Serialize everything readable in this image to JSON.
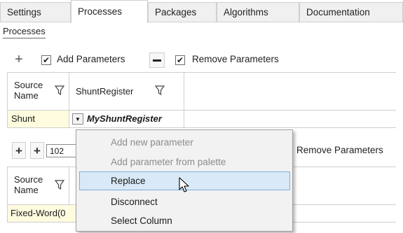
{
  "tabs": [
    {
      "label": "Settings"
    },
    {
      "label": "Processes",
      "active": true
    },
    {
      "label": "Packages"
    },
    {
      "label": "Algorithms"
    },
    {
      "label": "Documentation"
    }
  ],
  "section_title": "Processes",
  "toolbar1": {
    "add_parameters_label": "Add Parameters",
    "add_parameters_checked": true,
    "remove_parameters_label": "Remove Parameters",
    "remove_parameters_checked": true
  },
  "grid1": {
    "headers": [
      {
        "label_line1": "Source",
        "label_line2": "Name"
      },
      {
        "label": "ShuntRegister"
      }
    ],
    "row": {
      "source_name": "Shunt",
      "selected_value": "MyShuntRegister"
    }
  },
  "toolbar2": {
    "field_value": "102",
    "remove_parameters_label": "Remove Parameters"
  },
  "grid2": {
    "headers": [
      {
        "label_line1": "Source",
        "label_line2": "Name"
      }
    ],
    "row": {
      "source_name": "Fixed-Word(0"
    }
  },
  "context_menu": {
    "items": [
      {
        "label": "Add new parameter",
        "disabled": true
      },
      {
        "label": "Add parameter from palette",
        "disabled": true
      },
      {
        "label": "Replace",
        "highlighted": true
      },
      {
        "label": "Disconnect"
      },
      {
        "label": "Select Column"
      }
    ]
  },
  "colors": {
    "source_cell_bg": "#fffbdf",
    "menu_highlight": "#d9e9f7"
  }
}
